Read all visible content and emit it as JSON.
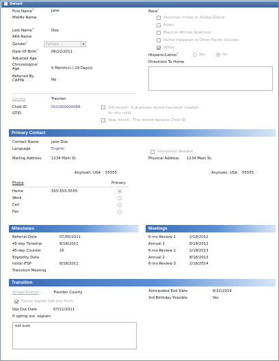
{
  "header": {
    "title": "Detail"
  },
  "detail": {
    "first_name_label": "First Name",
    "first_name": "Jane",
    "middle_name_label": "Middle Name",
    "last_name_label": "Last Name",
    "last_name": "Doe",
    "aka_label": "AKA Name",
    "gender_label": "Gender",
    "gender": "Female",
    "dob_label": "Date Of Birth",
    "dob": "06/22/2011",
    "adjusted_age_label": "Adjusted Age",
    "chrono_age_label": "Chronological Age",
    "chrono_age": "0 Month(s) / 29 Day(s)",
    "referred_label": "Referred By CAPTA",
    "referred": "No",
    "county_label": "County",
    "county": "Treutlen",
    "child_id_label": "Child ID",
    "child_id": "DU1000000088",
    "gtid_label": "GTID",
    "race_label": "Race",
    "race_options": [
      "American Indian or Alaska Native",
      "Asian",
      "Black or African American",
      "Native Hawaiian or Other Pacific Islander",
      "White"
    ],
    "race_checked": [
      false,
      false,
      false,
      false,
      true
    ],
    "hispanic_label": "Hispanic/Latino",
    "hispanic_yes": "Yes",
    "hispanic_no": "No",
    "directions_label": "Directions To Home",
    "old_record": "Old record - A duplicate record has been created for this child.",
    "new_record": "New record - This record replaces Child ID"
  },
  "primary_contact": {
    "section_title": "Primary Contact",
    "contact_name_label": "Contact Name",
    "contact_name": "Jane Doe",
    "language_label": "Language",
    "language": "English",
    "interpreter_label": "Interpreter Needed",
    "mailing_label": "Mailing Address",
    "mailing_street": "1234 Main St.",
    "mailing_city": "Anytown, USA",
    "mailing_zip": "55555",
    "physical_label": "Physical Address",
    "physical_street": "1234 Main St.",
    "physical_city": "Anytown, USA",
    "physical_zip": "55555",
    "phone_header": "Phone",
    "primary_header": "Primary",
    "phones": [
      {
        "label": "Home",
        "value": "555-555-5555",
        "primary": true
      },
      {
        "label": "Work",
        "value": "",
        "primary": false
      },
      {
        "label": "Cell",
        "value": "",
        "primary": false
      },
      {
        "label": "Fax",
        "value": "",
        "primary": false
      }
    ]
  },
  "milestones": {
    "section_title": "Milestones",
    "rows": [
      {
        "label": "Referral Date",
        "value": "07/05/2011"
      },
      {
        "label": "45-day Timeline",
        "value": "8/18/2011"
      },
      {
        "label": "45-day Counter",
        "value": "16"
      },
      {
        "label": "Eligibility Date",
        "value": ""
      },
      {
        "label": "Initial IFSP",
        "value": "8/18/2011"
      },
      {
        "label": "Transition Meeting",
        "value": ""
      }
    ]
  },
  "meetings": {
    "section_title": "Meetings",
    "rows": [
      {
        "label": "6-mo Review 1",
        "value": "2/18/2012"
      },
      {
        "label": "Annual 1",
        "value": "8/18/2012"
      },
      {
        "label": "6-mo Review 2",
        "value": "2/18/2013"
      },
      {
        "label": "Annual 2",
        "value": "8/18/2013"
      },
      {
        "label": "6-mo Review 3",
        "value": "2/18/2014"
      }
    ]
  },
  "transition": {
    "section_title": "Transition",
    "school_district_label": "School District",
    "school_district": "Treutlen County",
    "family_signed_label": "Family Signed Opt Out Form",
    "opt_out_label": "Opt Out Date",
    "opt_out_date": "07/11/2011",
    "explain_label": "If opting out, explain.",
    "explain_text": "not sure",
    "exit_date_label": "Anticipated Exit Date",
    "exit_date": "6/22/2014",
    "third_bday_label": "3rd Birthday Possible",
    "third_bday": "Yes"
  }
}
